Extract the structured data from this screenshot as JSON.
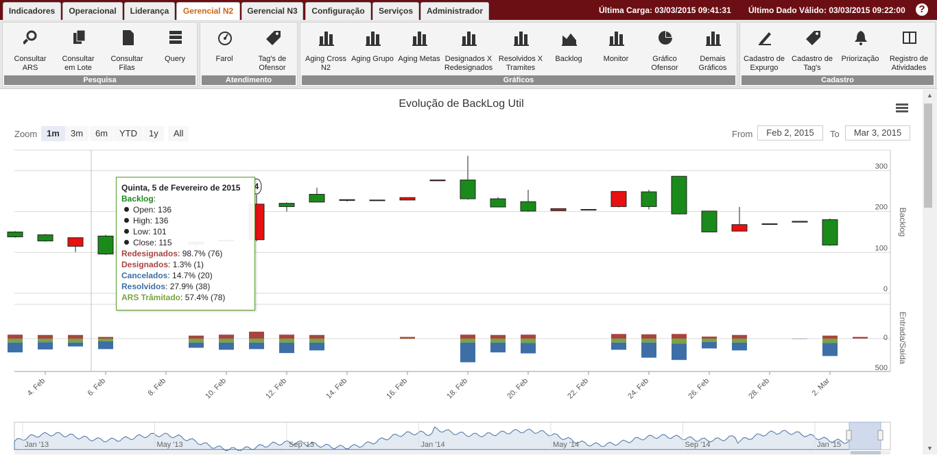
{
  "tabs": [
    {
      "label": "Indicadores",
      "active": false
    },
    {
      "label": "Operacional",
      "active": false
    },
    {
      "label": "Liderança",
      "active": false
    },
    {
      "label": "Gerencial N2",
      "active": true
    },
    {
      "label": "Gerencial N3",
      "active": false
    },
    {
      "label": "Configuração",
      "active": false
    },
    {
      "label": "Serviços",
      "active": false
    },
    {
      "label": "Administrador",
      "active": false
    }
  ],
  "header": {
    "ultima_carga": "Última Carga: 03/03/2015 09:41:31",
    "ultimo_dado": "Último Dado Válido: 03/03/2015 09:22:00",
    "help_icon": "?"
  },
  "ribbon": {
    "groups": [
      {
        "label": "Pesquisa",
        "buttons": [
          {
            "label": "Consultar\nARS",
            "icon": "search-icon"
          },
          {
            "label": "Consultar\nem Lote",
            "icon": "documents-icon"
          },
          {
            "label": "Consultar\nFilas",
            "icon": "document-icon"
          },
          {
            "label": "Query",
            "icon": "database-icon"
          }
        ]
      },
      {
        "label": "Atendimento",
        "buttons": [
          {
            "label": "Farol",
            "icon": "gauge-icon"
          },
          {
            "label": "Tag's de\nOfensor",
            "icon": "tag-icon"
          }
        ]
      },
      {
        "label": "Gráficos",
        "buttons": [
          {
            "label": "Aging Cross\nN2",
            "icon": "bar-chart-icon"
          },
          {
            "label": "Aging Grupo",
            "icon": "bar-chart-icon"
          },
          {
            "label": "Aging Metas",
            "icon": "bar-chart-icon"
          },
          {
            "label": "Designados X\nRedesignados",
            "icon": "bar-chart-icon"
          },
          {
            "label": "Resolvidos X\nTramites",
            "icon": "bar-chart-icon"
          },
          {
            "label": "Backlog",
            "icon": "area-chart-icon"
          },
          {
            "label": "Monitor",
            "icon": "bar-chart-icon"
          },
          {
            "label": "Gráfico\nOfensor",
            "icon": "pie-chart-icon"
          },
          {
            "label": "Demais\nGráficos",
            "icon": "bar-chart-icon"
          }
        ]
      },
      {
        "label": "Cadastro",
        "buttons": [
          {
            "label": "Cadastro de\nExpurgo",
            "icon": "pen-icon"
          },
          {
            "label": "Cadastro de\nTag's",
            "icon": "tag-icon"
          },
          {
            "label": "Priorização",
            "icon": "bell-icon"
          },
          {
            "label": "Registro de\nAtividades",
            "icon": "book-icon"
          }
        ]
      }
    ]
  },
  "chart": {
    "title": "Evolução de BackLog Util",
    "zoom_label": "Zoom",
    "zoom_buttons": [
      {
        "label": "1m",
        "active": true
      },
      {
        "label": "3m",
        "active": false
      },
      {
        "label": "6m",
        "active": false
      },
      {
        "label": "YTD",
        "active": false
      },
      {
        "label": "1y",
        "active": false
      },
      {
        "label": "All",
        "active": false
      }
    ],
    "from_label": "From",
    "from_value": "Feb 2, 2015",
    "to_label": "To",
    "to_value": "Mar 3, 2015",
    "colors": {
      "up": "#1a8a1a",
      "down": "#e81010",
      "redesignados": "#a94442",
      "designados": "#b94a48",
      "cancelados": "#3e6ea6",
      "resolvidos": "#3e6ea6",
      "ars_tramitado": "#7aa440",
      "border": "#222222"
    }
  },
  "tooltip": {
    "title": "Quinta, 5 de Fevereiro de 2015",
    "backlog_label": "Backlog",
    "rows": [
      {
        "label": "Open",
        "value": "136"
      },
      {
        "label": "High",
        "value": "136"
      },
      {
        "label": "Low",
        "value": "101"
      },
      {
        "label": "Close",
        "value": "115"
      }
    ],
    "stats": [
      {
        "label": "Redesignados",
        "value": "98.7% (76)",
        "color": "#a94442"
      },
      {
        "label": "Designados",
        "value": "1.3% (1)",
        "color": "#a94442"
      },
      {
        "label": "Cancelados",
        "value": "14.7% (20)",
        "color": "#3e6ea6"
      },
      {
        "label": "Resolvidos",
        "value": "27.9% (38)",
        "color": "#3e6ea6"
      },
      {
        "label": "ARS Trâmitado",
        "value": "57.4% (78)",
        "color": "#7aa440"
      }
    ]
  },
  "chart_data": {
    "type": "candlestick",
    "title": "Evolução de BackLog Util",
    "ylabel": "Backlog",
    "ylabel_bottom": "Entrada/Saída",
    "ylim": [
      0,
      350
    ],
    "yticks": [
      0,
      100,
      200,
      300
    ],
    "ylim_bottom": [
      0,
      500
    ],
    "yticks_bottom": [
      0,
      500
    ],
    "xticks": [
      "4. Feb",
      "6. Feb",
      "8. Feb",
      "10. Feb",
      "12. Feb",
      "14. Feb",
      "16. Feb",
      "18. Feb",
      "20. Feb",
      "22. Feb",
      "24. Feb",
      "26. Feb",
      "28. Feb",
      "2. Mar"
    ],
    "navigator_labels": [
      "Jan '13",
      "May '13",
      "Sep '13",
      "Jan '14",
      "May '14",
      "Sep '14",
      "Jan '15"
    ],
    "flag": {
      "date": "2015-02-11",
      "text": "4"
    },
    "candles": [
      {
        "date": "2015-02-03",
        "open": 138,
        "high": 152,
        "low": 136,
        "close": 150
      },
      {
        "date": "2015-02-04",
        "open": 128,
        "high": 145,
        "low": 126,
        "close": 143
      },
      {
        "date": "2015-02-05",
        "open": 136,
        "high": 136,
        "low": 101,
        "close": 115
      },
      {
        "date": "2015-02-06",
        "open": 96,
        "high": 143,
        "low": 94,
        "close": 140
      },
      {
        "date": "2015-02-09",
        "open": 120,
        "high": 128,
        "low": 108,
        "close": 125
      },
      {
        "date": "2015-02-10",
        "open": 128,
        "high": 134,
        "low": 120,
        "close": 130
      },
      {
        "date": "2015-02-11",
        "open": 218,
        "high": 221,
        "low": 127,
        "close": 131
      },
      {
        "date": "2015-02-12",
        "open": 212,
        "high": 222,
        "low": 200,
        "close": 220
      },
      {
        "date": "2015-02-13",
        "open": 223,
        "high": 258,
        "low": 222,
        "close": 242
      },
      {
        "date": "2015-02-14",
        "open": 229,
        "high": 229,
        "low": 224,
        "close": 227
      },
      {
        "date": "2015-02-15",
        "open": 228,
        "high": 228,
        "low": 226,
        "close": 227
      },
      {
        "date": "2015-02-16",
        "open": 234,
        "high": 234,
        "low": 227,
        "close": 228
      },
      {
        "date": "2015-02-17",
        "open": 277,
        "high": 277,
        "low": 274,
        "close": 275
      },
      {
        "date": "2015-02-18",
        "open": 231,
        "high": 336,
        "low": 229,
        "close": 277
      },
      {
        "date": "2015-02-19",
        "open": 211,
        "high": 235,
        "low": 210,
        "close": 231
      },
      {
        "date": "2015-02-20",
        "open": 201,
        "high": 253,
        "low": 199,
        "close": 224
      },
      {
        "date": "2015-02-21",
        "open": 207,
        "high": 207,
        "low": 201,
        "close": 202
      },
      {
        "date": "2015-02-22",
        "open": 205,
        "high": 205,
        "low": 204,
        "close": 204
      },
      {
        "date": "2015-02-23",
        "open": 249,
        "high": 250,
        "low": 210,
        "close": 212
      },
      {
        "date": "2015-02-24",
        "open": 212,
        "high": 253,
        "low": 205,
        "close": 248
      },
      {
        "date": "2015-02-25",
        "open": 194,
        "high": 287,
        "low": 193,
        "close": 286
      },
      {
        "date": "2015-02-26",
        "open": 150,
        "high": 202,
        "low": 150,
        "close": 201
      },
      {
        "date": "2015-02-27",
        "open": 168,
        "high": 211,
        "low": 152,
        "close": 152
      },
      {
        "date": "2015-02-28",
        "open": 170,
        "high": 170,
        "low": 169,
        "close": 170
      },
      {
        "date": "2015-03-01",
        "open": 176,
        "high": 176,
        "low": 174,
        "close": 174
      },
      {
        "date": "2015-03-02",
        "open": 118,
        "high": 183,
        "low": 116,
        "close": 180
      }
    ],
    "entrada_saida": [
      {
        "date": "2015-02-03",
        "red": 60,
        "green": 60,
        "blue": 150
      },
      {
        "date": "2015-02-04",
        "red": 55,
        "green": 55,
        "blue": 110
      },
      {
        "date": "2015-02-05",
        "red": 55,
        "green": 60,
        "blue": 60
      },
      {
        "date": "2015-02-06",
        "red": 25,
        "green": 40,
        "blue": 120
      },
      {
        "date": "2015-02-09",
        "red": 45,
        "green": 60,
        "blue": 80
      },
      {
        "date": "2015-02-10",
        "red": 60,
        "green": 60,
        "blue": 110
      },
      {
        "date": "2015-02-11",
        "red": 105,
        "green": 60,
        "blue": 100
      },
      {
        "date": "2015-02-12",
        "red": 60,
        "green": 60,
        "blue": 160
      },
      {
        "date": "2015-02-13",
        "red": 55,
        "green": 60,
        "blue": 120
      },
      {
        "date": "2015-02-16",
        "red": 25,
        "green": 5,
        "blue": 0
      },
      {
        "date": "2015-02-18",
        "red": 60,
        "green": 60,
        "blue": 300
      },
      {
        "date": "2015-02-19",
        "red": 55,
        "green": 60,
        "blue": 150
      },
      {
        "date": "2015-02-20",
        "red": 60,
        "green": 65,
        "blue": 160
      },
      {
        "date": "2015-02-21",
        "red": 0,
        "green": 0,
        "blue": 0
      },
      {
        "date": "2015-02-23",
        "red": 70,
        "green": 60,
        "blue": 110
      },
      {
        "date": "2015-02-24",
        "red": 65,
        "green": 60,
        "blue": 230
      },
      {
        "date": "2015-02-25",
        "red": 70,
        "green": 75,
        "blue": 250
      },
      {
        "date": "2015-02-26",
        "red": 30,
        "green": 50,
        "blue": 100
      },
      {
        "date": "2015-02-27",
        "red": 55,
        "green": 60,
        "blue": 120
      },
      {
        "date": "2015-03-01",
        "red": 0,
        "green": 0,
        "blue": 5
      },
      {
        "date": "2015-03-02",
        "red": 45,
        "green": 65,
        "blue": 200
      },
      {
        "date": "2015-03-03",
        "red": 25,
        "green": 0,
        "blue": 0
      }
    ]
  }
}
